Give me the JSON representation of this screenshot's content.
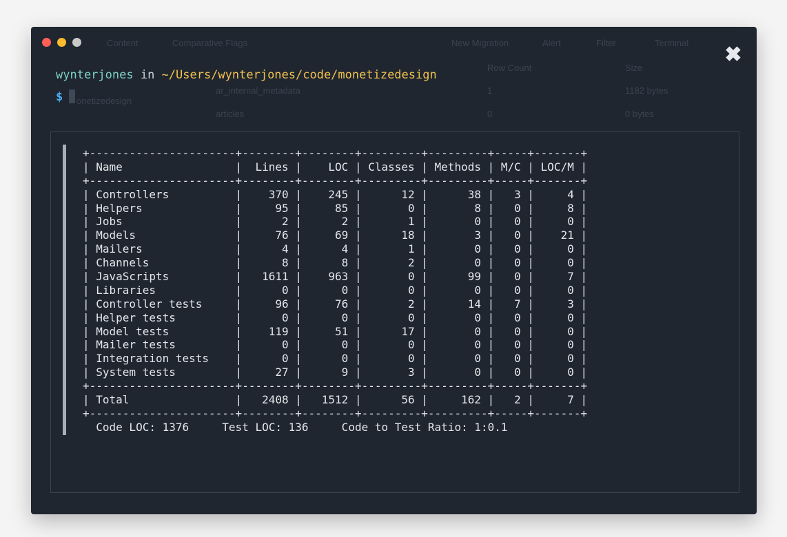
{
  "window": {
    "traffic_lights": [
      "#ff5f57",
      "#febc2e",
      "#c8c8c8"
    ],
    "close_icon": "close-x-icon",
    "ghost_toolbar": [
      "Content",
      "Comparative Flags",
      "New Migration",
      "Alert",
      "Filter",
      "Terminal"
    ],
    "ghost_headers": [
      "Row Count",
      "Size"
    ],
    "ghost_rows": [
      {
        "name": "ar_internal_metadata",
        "rows": "1",
        "size": "1182 bytes"
      },
      {
        "name": "articles",
        "rows": "0",
        "size": "0 bytes"
      }
    ],
    "ghost_sidebar": "onetizedesign"
  },
  "prompt": {
    "user": "wynterjones",
    "in": " in ",
    "path": "~/Users/wynterjones/code/monetizedesign",
    "symbol": "$"
  },
  "output": {
    "lines": [
      "+----------------------+--------+--------+---------+---------+-----+-------+",
      "| Name                 |  Lines |    LOC | Classes | Methods | M/C | LOC/M |",
      "+----------------------+--------+--------+---------+---------+-----+-------+",
      "| Controllers          |    370 |    245 |      12 |      38 |   3 |     4 |",
      "| Helpers              |     95 |     85 |       0 |       8 |   0 |     8 |",
      "| Jobs                 |      2 |      2 |       1 |       0 |   0 |     0 |",
      "| Models               |     76 |     69 |      18 |       3 |   0 |    21 |",
      "| Mailers              |      4 |      4 |       1 |       0 |   0 |     0 |",
      "| Channels             |      8 |      8 |       2 |       0 |   0 |     0 |",
      "| JavaScripts          |   1611 |    963 |       0 |      99 |   0 |     7 |",
      "| Libraries            |      0 |      0 |       0 |       0 |   0 |     0 |",
      "| Controller tests     |     96 |     76 |       2 |      14 |   7 |     3 |",
      "| Helper tests         |      0 |      0 |       0 |       0 |   0 |     0 |",
      "| Model tests          |    119 |     51 |      17 |       0 |   0 |     0 |",
      "| Mailer tests         |      0 |      0 |       0 |       0 |   0 |     0 |",
      "| Integration tests    |      0 |      0 |       0 |       0 |   0 |     0 |",
      "| System tests         |     27 |      9 |       3 |       0 |   0 |     0 |",
      "+----------------------+--------+--------+---------+---------+-----+-------+",
      "| Total                |   2408 |   1512 |      56 |     162 |   2 |     7 |",
      "+----------------------+--------+--------+---------+---------+-----+-------+",
      "  Code LOC: 1376     Test LOC: 136     Code to Test Ratio: 1:0.1"
    ]
  }
}
